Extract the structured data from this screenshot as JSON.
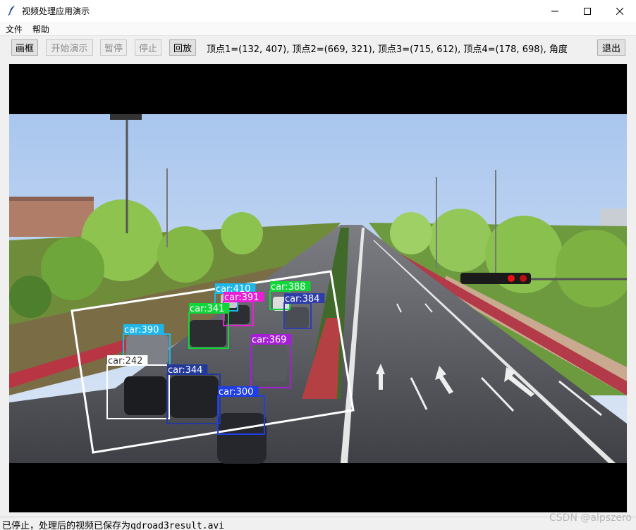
{
  "window": {
    "title": "视频处理应用演示",
    "icon": "feather-icon"
  },
  "menu": {
    "file": "文件",
    "help": "帮助"
  },
  "toolbar": {
    "draw_box": "画框",
    "start_demo": "开始演示",
    "pause": "暂停",
    "stop": "停止",
    "replay": "回放",
    "info_text": "：顶点1=(132, 407), 顶点2=(669, 321), 顶点3=(715, 612), 顶点4=(178, 698), 角度",
    "exit": "退出"
  },
  "detections": [
    {
      "label": "car:410",
      "color": "#1fb6ea"
    },
    {
      "label": "car:388",
      "color": "#11d63a"
    },
    {
      "label": "car:391",
      "color": "#e81fd4"
    },
    {
      "label": "car:384",
      "color": "#2e3ea8"
    },
    {
      "label": "car:341",
      "color": "#11d63a"
    },
    {
      "label": "car:390",
      "color": "#1fb6ea"
    },
    {
      "label": "car:369",
      "color": "#a61fd6"
    },
    {
      "label": "car:242",
      "color": "#ffffff"
    },
    {
      "label": "car:344",
      "color": "#22399a"
    },
    {
      "label": "car:300",
      "color": "#1f3ee6"
    }
  ],
  "status": {
    "message": "已停止，处理后的视频已保存为qdroad3result.avi"
  },
  "watermark": "CSDN @alpszero"
}
